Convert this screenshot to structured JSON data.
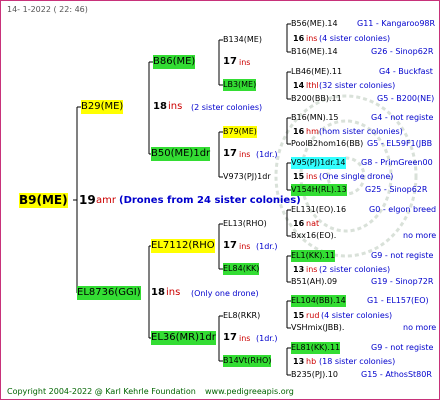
{
  "header": {
    "date": "14-   1-2022  (  22:  46)"
  },
  "footer": {
    "copyright": "Copyright 2004-2022 @ Karl Kehrle Foundation",
    "site": "www.pedigreeapis.org"
  },
  "colors": {
    "border": "#c8327a",
    "yellow": "#ffff00",
    "green": "#33dd33",
    "cyan": "#33ffff",
    "blue": "#0000cc",
    "red": "#cc0000"
  },
  "gen1": {
    "name": "B9(ME)",
    "year": "19",
    "info": "amr",
    "remark": "(Drones from 24 sister colonies)"
  },
  "gen2": [
    {
      "name": "B29(ME)",
      "year": "18",
      "info": "ins",
      "remark": "(2 sister colonies)"
    },
    {
      "name": "EL8736(GGI)",
      "year": "18",
      "info": "ins",
      "remark": "(Only one drone)"
    }
  ],
  "gen3": [
    {
      "name": "B86(ME)"
    },
    {
      "name": "B50(ME)1dr",
      "year": "17",
      "info": "ins",
      "remark": "(1dr.)"
    },
    {
      "name": "EL7112(RHO",
      "year": "17",
      "info": "ins",
      "remark": "(1dr.)"
    },
    {
      "name": "EL36(MR)1dr",
      "year": "17",
      "info": "ins",
      "remark": "(1dr.)"
    }
  ],
  "gen4": [
    {
      "name": "B134(ME)",
      "year": "17",
      "info": "ins"
    },
    {
      "name": "LB3(ME)"
    },
    {
      "name": "B79(ME)",
      "year": "16",
      "info": "ins"
    },
    {
      "name": "V973(PJ)1dr",
      "year": "17",
      "info": "ins"
    },
    {
      "name": "EL13(RHO)",
      "year": "16",
      "info": "nat"
    },
    {
      "name": "EL84(KK)"
    },
    {
      "name": "EL8(RKR)",
      "year": "15",
      "info": "ins"
    },
    {
      "name": "B14Vt(RHO)",
      "year": "13",
      "info": "ins"
    }
  ],
  "gen5": [
    {
      "name": "B56(ME).14",
      "breeder": "G11 - Kangaroo98R"
    },
    {
      "name": "16",
      "info": "ins",
      "remark": "(4 sister colonies)"
    },
    {
      "name": "B16(ME).14",
      "breeder": "G26 - Sinop62R"
    },
    {
      "name": "LB46(ME).11",
      "breeder": "G4 - Buckfast"
    },
    {
      "name": "14",
      "info": "lthl",
      "remark": "(32 sister colonies)"
    },
    {
      "name": "B200(BB).11",
      "breeder": "G5 - B200(NE)"
    },
    {
      "name": "B16(MN).15",
      "breeder": "G4 - not registe"
    },
    {
      "name": "16",
      "info": "hm",
      "remark": "(hom sister colonies)"
    },
    {
      "name": "PoolB2hom16(BB)",
      "breeder": "G5 - EL59F1(JBB"
    },
    {
      "name": "V95(PJ)1dr.14",
      "breeder": "G8 - PrimGreen00"
    },
    {
      "name": "15",
      "info": "ins",
      "remark": "(One single drone)"
    },
    {
      "name": "V154H(RL).13",
      "breeder": "G25 - Sinop62R"
    },
    {
      "name": "EL131(EO).16",
      "breeder": "G0 - elgon breed"
    },
    {
      "name": "16",
      "info": "nat"
    },
    {
      "name": "Bxx16(EO).",
      "breeder": "no more"
    },
    {
      "name": "EL1(KK).11",
      "breeder": "G9 - not registe"
    },
    {
      "name": "13",
      "info": "ins",
      "remark": "(2 sister colonies)"
    },
    {
      "name": "B51(AH).09",
      "breeder": "G19 - Sinop72R"
    },
    {
      "name": "EL104(BB).14",
      "breeder": "G1 - EL157(EO)"
    },
    {
      "name": "15",
      "info": "rud",
      "remark": "(4 sister colonies)"
    },
    {
      "name": "VSHmix(JBB).",
      "breeder": "no more"
    },
    {
      "name": "EL81(KK).11",
      "breeder": "G9 - not registe"
    },
    {
      "name": "13",
      "info": "hb",
      "remark": "(18 sister colonies)"
    },
    {
      "name": "B235(PJ).10",
      "breeder": "G15 - AthosSt80R"
    }
  ]
}
